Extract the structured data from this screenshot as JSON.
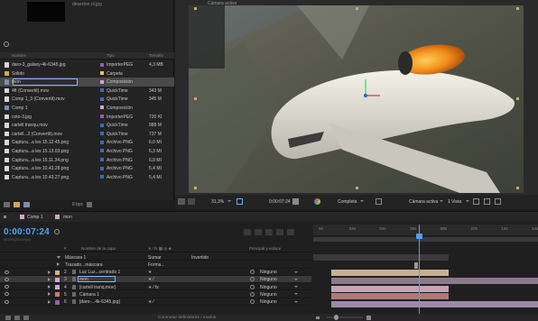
{
  "project": {
    "thumbnail_filename": "deserton.nl.jpg",
    "columns": {
      "name": "Nombre",
      "type": "Tipo",
      "size": "Tamaño"
    },
    "items": [
      {
        "name": "daro-3_galaxy-4k-6345.jpg",
        "type": "ImporterPEG",
        "size": "4,3 MB",
        "icon": "image-file-icon",
        "icon_color": "#d8d8d8",
        "label_color": "#9b59b6",
        "selected": false,
        "editing": false
      },
      {
        "name": "Sólido",
        "type": "Carpeta",
        "size": "",
        "icon": "folder-icon",
        "icon_color": "#d0a85a",
        "label_color": "#f0c060",
        "selected": false,
        "editing": false
      },
      {
        "name": "mon",
        "type": "Composición",
        "size": "",
        "icon": "composition-icon",
        "icon_color": "#7f8fa6",
        "label_color": "#d3a6c8",
        "selected": true,
        "editing": true
      },
      {
        "name": "4ft (Convertit).mov",
        "type": "QuickTime",
        "size": "343 M",
        "icon": "video-file-icon",
        "icon_color": "#d8d8d8",
        "label_color": "#3b6bb8",
        "selected": false,
        "editing": false
      },
      {
        "name": "Comp 1_3 (Convertit).mov",
        "type": "QuickTime",
        "size": "345 M",
        "icon": "video-file-icon",
        "icon_color": "#d8d8d8",
        "label_color": "#3b6bb8",
        "selected": false,
        "editing": false
      },
      {
        "name": "Comp 1",
        "type": "Composición",
        "size": "",
        "icon": "composition-icon",
        "icon_color": "#7f8fa6",
        "label_color": "#d3a6c8",
        "selected": false,
        "editing": false
      },
      {
        "name": "coto-3.jpg",
        "type": "ImporterPEG",
        "size": "720 KI",
        "icon": "image-file-icon",
        "icon_color": "#d8d8d8",
        "label_color": "#9b59b6",
        "selected": false,
        "editing": false
      },
      {
        "name": "cartell tranqu.mov",
        "type": "QuickTime",
        "size": "988 M",
        "icon": "video-file-icon",
        "icon_color": "#d8d8d8",
        "label_color": "#3b6bb8",
        "selected": false,
        "editing": false
      },
      {
        "name": "cartell...2 (Convertit).mov",
        "type": "QuickTime",
        "size": "737 M",
        "icon": "video-file-icon",
        "icon_color": "#d8d8d8",
        "label_color": "#3b6bb8",
        "selected": false,
        "editing": false
      },
      {
        "name": "Captura...a les 15.12.45.png",
        "type": "Archivo PNG",
        "size": "6,0 MI",
        "icon": "image-file-icon",
        "icon_color": "#d8d8d8",
        "label_color": "#3b6bb8",
        "selected": false,
        "editing": false
      },
      {
        "name": "Captura...a les 15.13.03.png",
        "type": "Archivo PNG",
        "size": "6,3 MI",
        "icon": "image-file-icon",
        "icon_color": "#d8d8d8",
        "label_color": "#3b6bb8",
        "selected": false,
        "editing": false
      },
      {
        "name": "Captura...a les 15.11.34.png",
        "type": "Archivo PNG",
        "size": "6,8 MI",
        "icon": "image-file-icon",
        "icon_color": "#d8d8d8",
        "label_color": "#3b6bb8",
        "selected": false,
        "editing": false
      },
      {
        "name": "Captura...a les 10.43.28.png",
        "type": "Archivo PNG",
        "size": "5,4 MI",
        "icon": "image-file-icon",
        "icon_color": "#d8d8d8",
        "label_color": "#3b6bb8",
        "selected": false,
        "editing": false
      },
      {
        "name": "Captura...a les 10.43.27.png",
        "type": "Archivo PNG",
        "size": "5,4 MI",
        "icon": "image-file-icon",
        "icon_color": "#d8d8d8",
        "label_color": "#3b6bb8",
        "selected": false,
        "editing": false
      }
    ],
    "bpc": "8 bpc"
  },
  "viewer": {
    "title": "Cámara activa",
    "zoom": "31,3%",
    "timecode": "0:00:07:24",
    "resolution": "Completa",
    "camera": "Cámara activa",
    "views": "1 Vista"
  },
  "timeline": {
    "tabs": [
      {
        "label": "Comp 1",
        "active": true,
        "color": "#d3a6c8"
      },
      {
        "label": "mon",
        "active": false,
        "color": "#d3a6c8"
      }
    ],
    "timecode": "0:00:07:24",
    "fps_info": "00199 (25.00 fps)",
    "headers": {
      "num": "#",
      "name": "Nombre de la capa",
      "switches": "∗ ⁄ fx ▩ ◎ ◈",
      "parent": "Principal y enlace"
    },
    "layers": [
      {
        "num": "",
        "name": "Máscara 1",
        "indent": true,
        "open": true,
        "label_color": "",
        "switches": "",
        "extra1": "Sumar",
        "extra2": "Invertido",
        "parent": "",
        "selected": false
      },
      {
        "num": "",
        "name": "Trazado...máscara",
        "indent": true,
        "open": false,
        "label_color": "",
        "switches": "",
        "extra1": "Forma...",
        "extra2": "",
        "parent": "",
        "selected": false
      },
      {
        "num": "2",
        "name": "Luz Luz...centrado 1",
        "indent": false,
        "open": false,
        "label_color": "#e0b070",
        "switches": "∗",
        "extra1": "",
        "extra2": "",
        "parent": "Ninguno",
        "selected": false
      },
      {
        "num": "3",
        "name": "mon",
        "indent": false,
        "open": false,
        "label_color": "#d3a6c8",
        "switches": "∗   ⁄",
        "extra1": "",
        "extra2": "",
        "parent": "Ninguno",
        "selected": true
      },
      {
        "num": "4",
        "name": "[cartell tranq.mov]",
        "indent": false,
        "open": false,
        "label_color": "#d3a6c8",
        "switches": "∗   ⁄ fx",
        "extra1": "",
        "extra2": "",
        "parent": "Ninguno",
        "selected": false
      },
      {
        "num": "5",
        "name": "Cámara 1",
        "indent": false,
        "open": false,
        "label_color": "#e07070",
        "switches": "",
        "extra1": "",
        "extra2": "",
        "parent": "Ninguno",
        "selected": false
      },
      {
        "num": "6",
        "name": "[daro-...4k-6345.jpg]",
        "indent": false,
        "open": false,
        "label_color": "#9b59b6",
        "switches": "∗   ⁄",
        "extra1": "",
        "extra2": "",
        "parent": "Ninguno",
        "selected": false
      }
    ],
    "ruler_ticks": [
      "0s",
      "02s",
      "04s",
      "06s",
      "08s",
      "10s",
      "12s",
      "14s"
    ],
    "playhead_fraction": 0.47,
    "footer_label": "Conmutar definidores / modos"
  },
  "colors": {
    "accent": "#4ea1ff",
    "panel": "#232323",
    "selected": "#4a4a4a"
  }
}
